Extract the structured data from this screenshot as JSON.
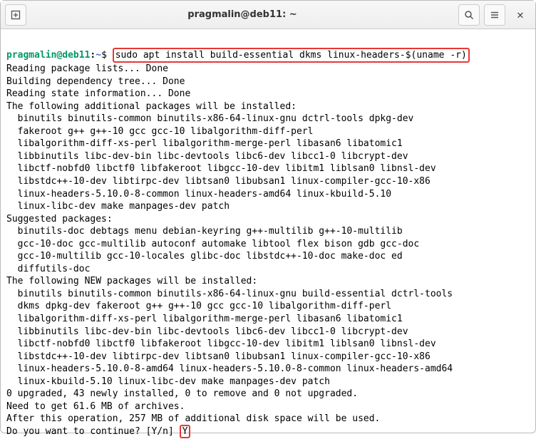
{
  "titlebar": {
    "title": "pragmalin@deb11: ~"
  },
  "prompt": {
    "user_host": "pragmalin@deb11",
    "sep": ":",
    "path": "~",
    "dollar": "$",
    "command": "sudo apt install build-essential dkms linux-headers-$(uname -r)"
  },
  "output": {
    "l01": "Reading package lists... Done",
    "l02": "Building dependency tree... Done",
    "l03": "Reading state information... Done",
    "l04": "The following additional packages will be installed:",
    "l05": "  binutils binutils-common binutils-x86-64-linux-gnu dctrl-tools dpkg-dev",
    "l06": "  fakeroot g++ g++-10 gcc gcc-10 libalgorithm-diff-perl",
    "l07": "  libalgorithm-diff-xs-perl libalgorithm-merge-perl libasan6 libatomic1",
    "l08": "  libbinutils libc-dev-bin libc-devtools libc6-dev libcc1-0 libcrypt-dev",
    "l09": "  libctf-nobfd0 libctf0 libfakeroot libgcc-10-dev libitm1 liblsan0 libnsl-dev",
    "l10": "  libstdc++-10-dev libtirpc-dev libtsan0 libubsan1 linux-compiler-gcc-10-x86",
    "l11": "  linux-headers-5.10.0-8-common linux-headers-amd64 linux-kbuild-5.10",
    "l12": "  linux-libc-dev make manpages-dev patch",
    "l13": "Suggested packages:",
    "l14": "  binutils-doc debtags menu debian-keyring g++-multilib g++-10-multilib",
    "l15": "  gcc-10-doc gcc-multilib autoconf automake libtool flex bison gdb gcc-doc",
    "l16": "  gcc-10-multilib gcc-10-locales glibc-doc libstdc++-10-doc make-doc ed",
    "l17": "  diffutils-doc",
    "l18": "The following NEW packages will be installed:",
    "l19": "  binutils binutils-common binutils-x86-64-linux-gnu build-essential dctrl-tools",
    "l20": "  dkms dpkg-dev fakeroot g++ g++-10 gcc gcc-10 libalgorithm-diff-perl",
    "l21": "  libalgorithm-diff-xs-perl libalgorithm-merge-perl libasan6 libatomic1",
    "l22": "  libbinutils libc-dev-bin libc-devtools libc6-dev libcc1-0 libcrypt-dev",
    "l23": "  libctf-nobfd0 libctf0 libfakeroot libgcc-10-dev libitm1 liblsan0 libnsl-dev",
    "l24": "  libstdc++-10-dev libtirpc-dev libtsan0 libubsan1 linux-compiler-gcc-10-x86",
    "l25": "  linux-headers-5.10.0-8-amd64 linux-headers-5.10.0-8-common linux-headers-amd64",
    "l26": "  linux-kbuild-5.10 linux-libc-dev make manpages-dev patch",
    "l27": "0 upgraded, 43 newly installed, 0 to remove and 0 not upgraded.",
    "l28": "Need to get 61.6 MB of archives.",
    "l29": "After this operation, 257 MB of additional disk space will be used.",
    "l30a": "Do you want to continue? [Y/n] ",
    "l30b": "Y"
  }
}
